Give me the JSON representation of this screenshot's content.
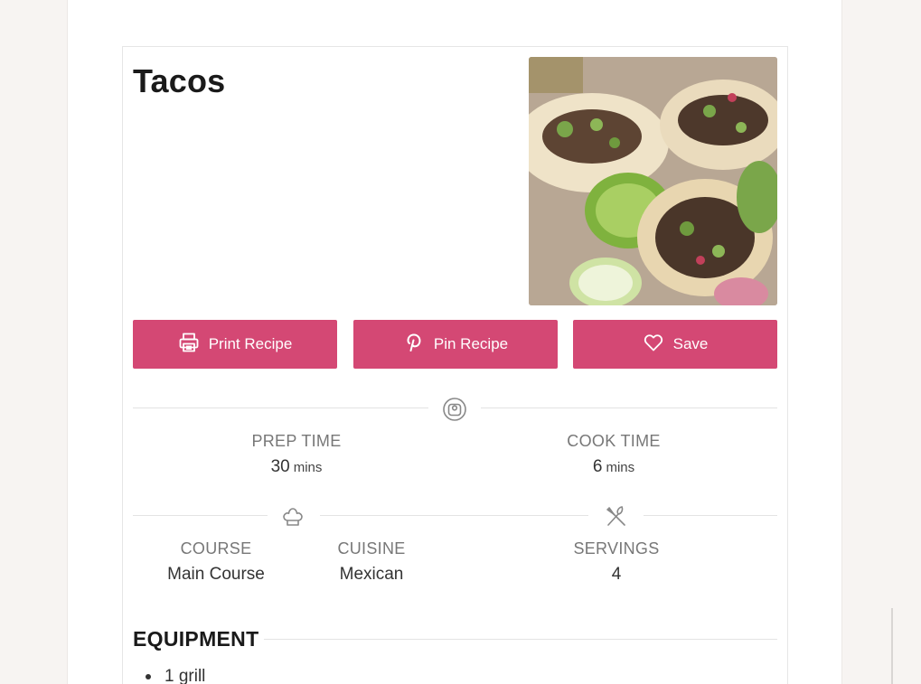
{
  "recipe": {
    "title": "Tacos",
    "buttons": {
      "print": "Print Recipe",
      "pin": "Pin Recipe",
      "save": "Save"
    },
    "times": {
      "prep_label": "PREP TIME",
      "prep_value": "30",
      "prep_unit": "mins",
      "cook_label": "COOK TIME",
      "cook_value": "6",
      "cook_unit": "mins"
    },
    "details": {
      "course_label": "COURSE",
      "course_value": "Main Course",
      "cuisine_label": "CUISINE",
      "cuisine_value": "Mexican",
      "servings_label": "SERVINGS",
      "servings_value": "4"
    },
    "equipment": {
      "heading": "EQUIPMENT",
      "items": [
        "1 grill"
      ]
    }
  },
  "colors": {
    "accent": "#d44874",
    "background": "#f7f4f2"
  },
  "icons": [
    "print-icon",
    "pinterest-icon",
    "heart-icon",
    "timer-icon",
    "chef-hat-icon",
    "utensils-icon"
  ]
}
